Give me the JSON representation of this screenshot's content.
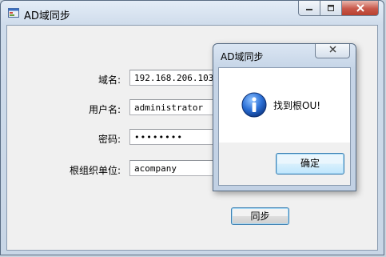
{
  "window": {
    "title": "AD域同步",
    "icon": "app-icon",
    "controls": {
      "minimize": "minimize-icon",
      "maximize": "maximize-icon",
      "close": "close-icon"
    }
  },
  "form": {
    "domain_label": "域名:",
    "domain_value": "192.168.206.103",
    "username_label": "用户名:",
    "username_value": "administrator",
    "password_label": "密码:",
    "password_value": "••••••••",
    "root_ou_label": "根组织单位:",
    "root_ou_value": "acompany",
    "sync_button": "同步"
  },
  "dialog": {
    "title": "AD域同步",
    "message": "找到根OU!",
    "icon": "info-icon",
    "ok_button": "确定"
  },
  "colors": {
    "info_icon_blue": "#1f5fbf",
    "close_button_red": "#c8584a",
    "window_frame": "#c8d6e6"
  }
}
